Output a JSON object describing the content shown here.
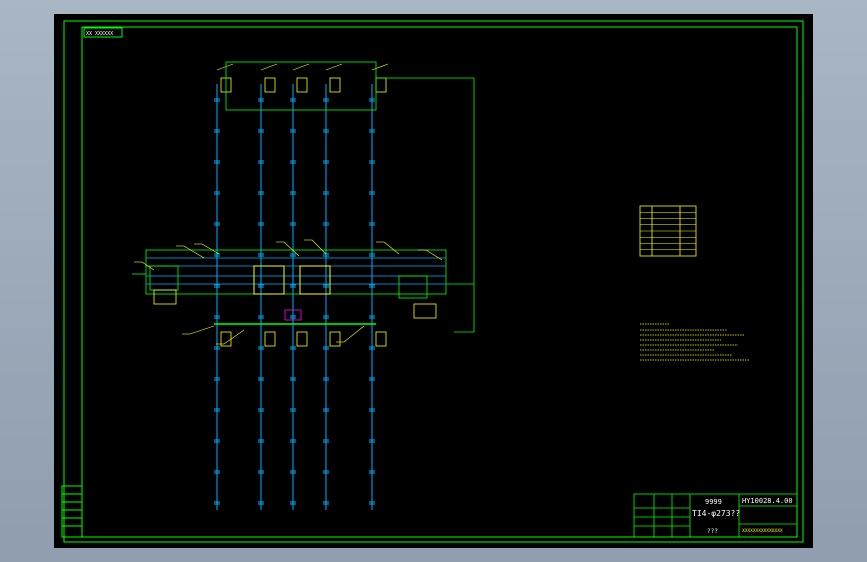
{
  "drawing": {
    "header_tag": "XX XXXXXX",
    "title_block": {
      "code": "HY10028.4.00",
      "name_line1": "9999",
      "name_line2": "TI4-φ273??",
      "bottom_text": "???",
      "company": "XXXXXXXXXXXXXXX"
    }
  },
  "colors": {
    "frame": "#00ff00",
    "pipe": "#00b0ff",
    "annotation": "#ffff00",
    "text": "#ffffff",
    "highlight": "#ff00ff",
    "background": "#000000"
  }
}
